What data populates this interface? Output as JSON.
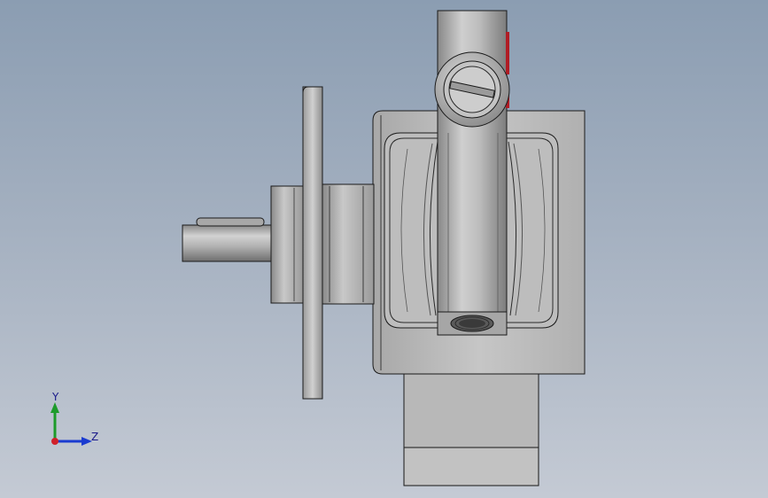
{
  "window": {
    "title": ""
  },
  "viewport": {
    "background_top": "#8b9db2",
    "background_bottom": "#c4cad4"
  },
  "model": {
    "name": "",
    "body_color": "#b5b5b5",
    "edge_color": "#1a1a1a",
    "accent_color": "#b01c24"
  },
  "triad": {
    "y_label": "Y",
    "z_label": "Z",
    "y_color": "#1d9b2a",
    "z_color": "#1a3bd0",
    "x_color": "#d0202a"
  }
}
